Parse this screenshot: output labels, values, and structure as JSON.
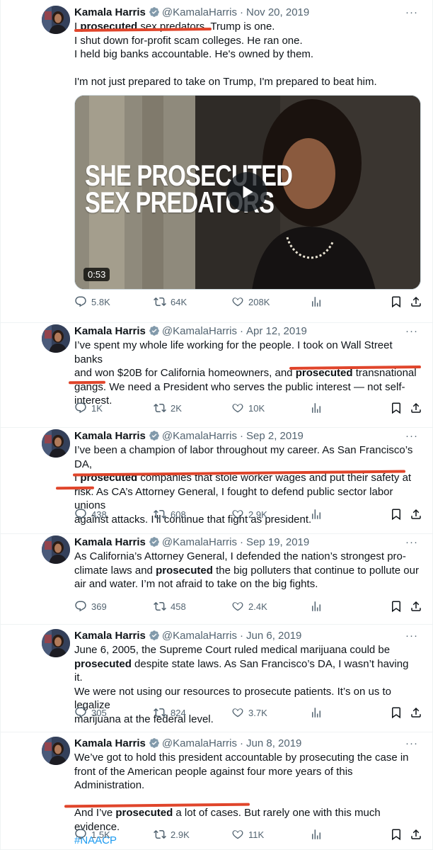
{
  "tweets": [
    {
      "author": {
        "name": "Kamala Harris",
        "handle": "@KamalaHarris"
      },
      "date": "Nov 20, 2019",
      "lines": [
        {
          "pre": "I ",
          "bold": "prosecuted",
          "post": " sex predators. Trump is one."
        },
        {
          "text": "I shut down for-profit scam colleges. He ran one."
        },
        {
          "text": "I held big banks accountable. He's owned by them."
        },
        {
          "gap": true
        },
        {
          "text": "I'm not just prepared to take on Trump, I'm prepared to beat him."
        }
      ],
      "video": {
        "overlay_line1": "SHE PROSECUTED",
        "overlay_line2": "SEX PREDATORS",
        "duration": "0:53"
      },
      "stats": {
        "replies": "5.8K",
        "reposts": "64K",
        "likes": "208K"
      }
    },
    {
      "author": {
        "name": "Kamala Harris",
        "handle": "@KamalaHarris"
      },
      "date": "Apr 12, 2019",
      "lines": [
        {
          "text": "I’ve spent my whole life working for the people. I took on Wall Street banks"
        },
        {
          "pre": "and won $20B for California homeowners, and ",
          "bold": "prosecuted",
          "post": " transnational"
        },
        {
          "text": "gangs. We need a President who serves the public interest — not self-"
        },
        {
          "text": "interest."
        }
      ],
      "stats": {
        "replies": "1K",
        "reposts": "2K",
        "likes": "10K"
      }
    },
    {
      "author": {
        "name": "Kamala Harris",
        "handle": "@KamalaHarris"
      },
      "date": "Sep 2, 2019",
      "lines": [
        {
          "text": "I’ve been a champion of labor throughout my career. As San Francisco’s DA,"
        },
        {
          "pre": "I ",
          "bold": "prosecuted",
          "post": " companies that stole worker wages and put their safety at"
        },
        {
          "text": "risk. As CA’s Attorney General, I fought to defend public sector labor unions"
        },
        {
          "text": "against attacks. I’ll continue that fight as president."
        }
      ],
      "stats": {
        "replies": "438",
        "reposts": "608",
        "likes": "2.9K"
      }
    },
    {
      "author": {
        "name": "Kamala Harris",
        "handle": "@KamalaHarris"
      },
      "date": "Sep 19, 2019",
      "lines": [
        {
          "text": "As California’s Attorney General, I defended the nation’s strongest pro-"
        },
        {
          "pre": "climate laws and ",
          "bold": "prosecuted",
          "post": " the big polluters that continue to pollute our"
        },
        {
          "text": "air and water. I’m not afraid to take on the big fights."
        }
      ],
      "stats": {
        "replies": "369",
        "reposts": "458",
        "likes": "2.4K"
      }
    },
    {
      "author": {
        "name": "Kamala Harris",
        "handle": "@KamalaHarris"
      },
      "date": "Jun 6, 2019",
      "lines": [
        {
          "text": "June 6, 2005, the Supreme Court ruled medical marijuana could be"
        },
        {
          "pre": "",
          "bold": "prosecuted",
          "post": " despite state laws. As San Francisco’s DA, I wasn’t having it."
        },
        {
          "text": "We were not using our resources to prosecute patients. It’s on us to legalize"
        },
        {
          "text": "marijuana at the federal level."
        }
      ],
      "stats": {
        "replies": "305",
        "reposts": "824",
        "likes": "3.7K"
      }
    },
    {
      "author": {
        "name": "Kamala Harris",
        "handle": "@KamalaHarris"
      },
      "date": "Jun 8, 2019",
      "lines": [
        {
          "text": "We’ve got to hold this president accountable by prosecuting the case in"
        },
        {
          "text": "front of the American people against four more years of this Administration."
        },
        {
          "gap": true
        },
        {
          "pre": "And I’ve ",
          "bold": "prosecuted",
          "post": " a lot of cases. But rarely one with this much evidence."
        },
        {
          "hashtag": "#NAACP"
        }
      ],
      "stats": {
        "replies": "1.5K",
        "reposts": "2.9K",
        "likes": "11K"
      }
    }
  ],
  "ui": {
    "separator": "·",
    "more": "···"
  },
  "colors": {
    "accent": "#1d9bf0",
    "muted": "#536471",
    "annotation": "#e0452b",
    "verified": "#1d9bf0"
  },
  "icons": [
    "reply-icon",
    "repost-icon",
    "like-icon",
    "views-icon",
    "bookmark-icon",
    "share-icon",
    "verified-badge-icon",
    "play-icon",
    "more-icon"
  ]
}
